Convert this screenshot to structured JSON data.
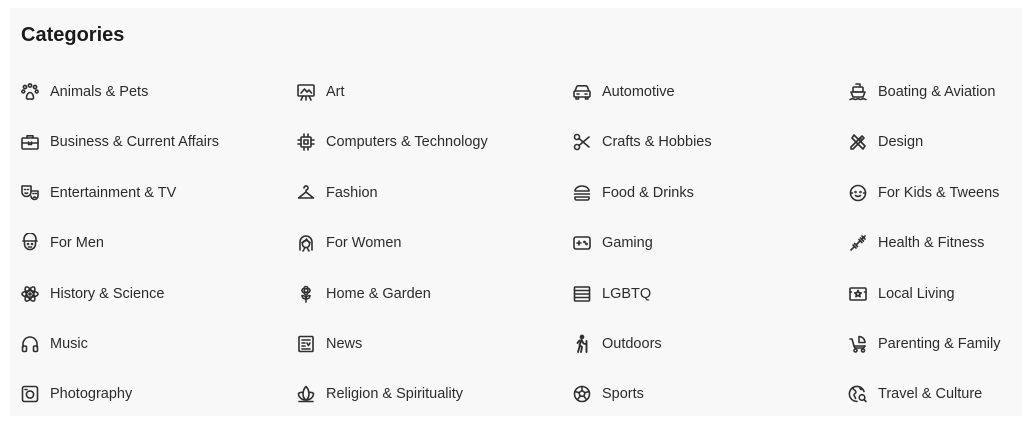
{
  "section": {
    "title": "Categories"
  },
  "categories": [
    {
      "label": "Animals & Pets",
      "icon": "paw-icon"
    },
    {
      "label": "Art",
      "icon": "easel-icon"
    },
    {
      "label": "Automotive",
      "icon": "car-icon"
    },
    {
      "label": "Boating & Aviation",
      "icon": "ship-icon"
    },
    {
      "label": "Business & Current Affairs",
      "icon": "briefcase-icon"
    },
    {
      "label": "Computers & Technology",
      "icon": "chip-icon"
    },
    {
      "label": "Crafts & Hobbies",
      "icon": "scissors-icon"
    },
    {
      "label": "Design",
      "icon": "design-tools-icon"
    },
    {
      "label": "Entertainment & TV",
      "icon": "theater-masks-icon"
    },
    {
      "label": "Fashion",
      "icon": "hanger-icon"
    },
    {
      "label": "Food & Drinks",
      "icon": "burger-icon"
    },
    {
      "label": "For Kids & Tweens",
      "icon": "kid-face-icon"
    },
    {
      "label": "For Men",
      "icon": "man-face-icon"
    },
    {
      "label": "For Women",
      "icon": "woman-face-icon"
    },
    {
      "label": "Gaming",
      "icon": "gamepad-icon"
    },
    {
      "label": "Health & Fitness",
      "icon": "dumbbell-icon"
    },
    {
      "label": "History & Science",
      "icon": "atom-icon"
    },
    {
      "label": "Home & Garden",
      "icon": "flower-icon"
    },
    {
      "label": "LGBTQ",
      "icon": "flag-icon"
    },
    {
      "label": "Local Living",
      "icon": "map-pin-icon"
    },
    {
      "label": "Music",
      "icon": "headphones-icon"
    },
    {
      "label": "News",
      "icon": "newspaper-icon"
    },
    {
      "label": "Outdoors",
      "icon": "hiker-icon"
    },
    {
      "label": "Parenting & Family",
      "icon": "stroller-icon"
    },
    {
      "label": "Photography",
      "icon": "camera-icon"
    },
    {
      "label": "Religion & Spirituality",
      "icon": "lotus-icon"
    },
    {
      "label": "Sports",
      "icon": "ball-icon"
    },
    {
      "label": "Travel & Culture",
      "icon": "globe-icon"
    }
  ]
}
